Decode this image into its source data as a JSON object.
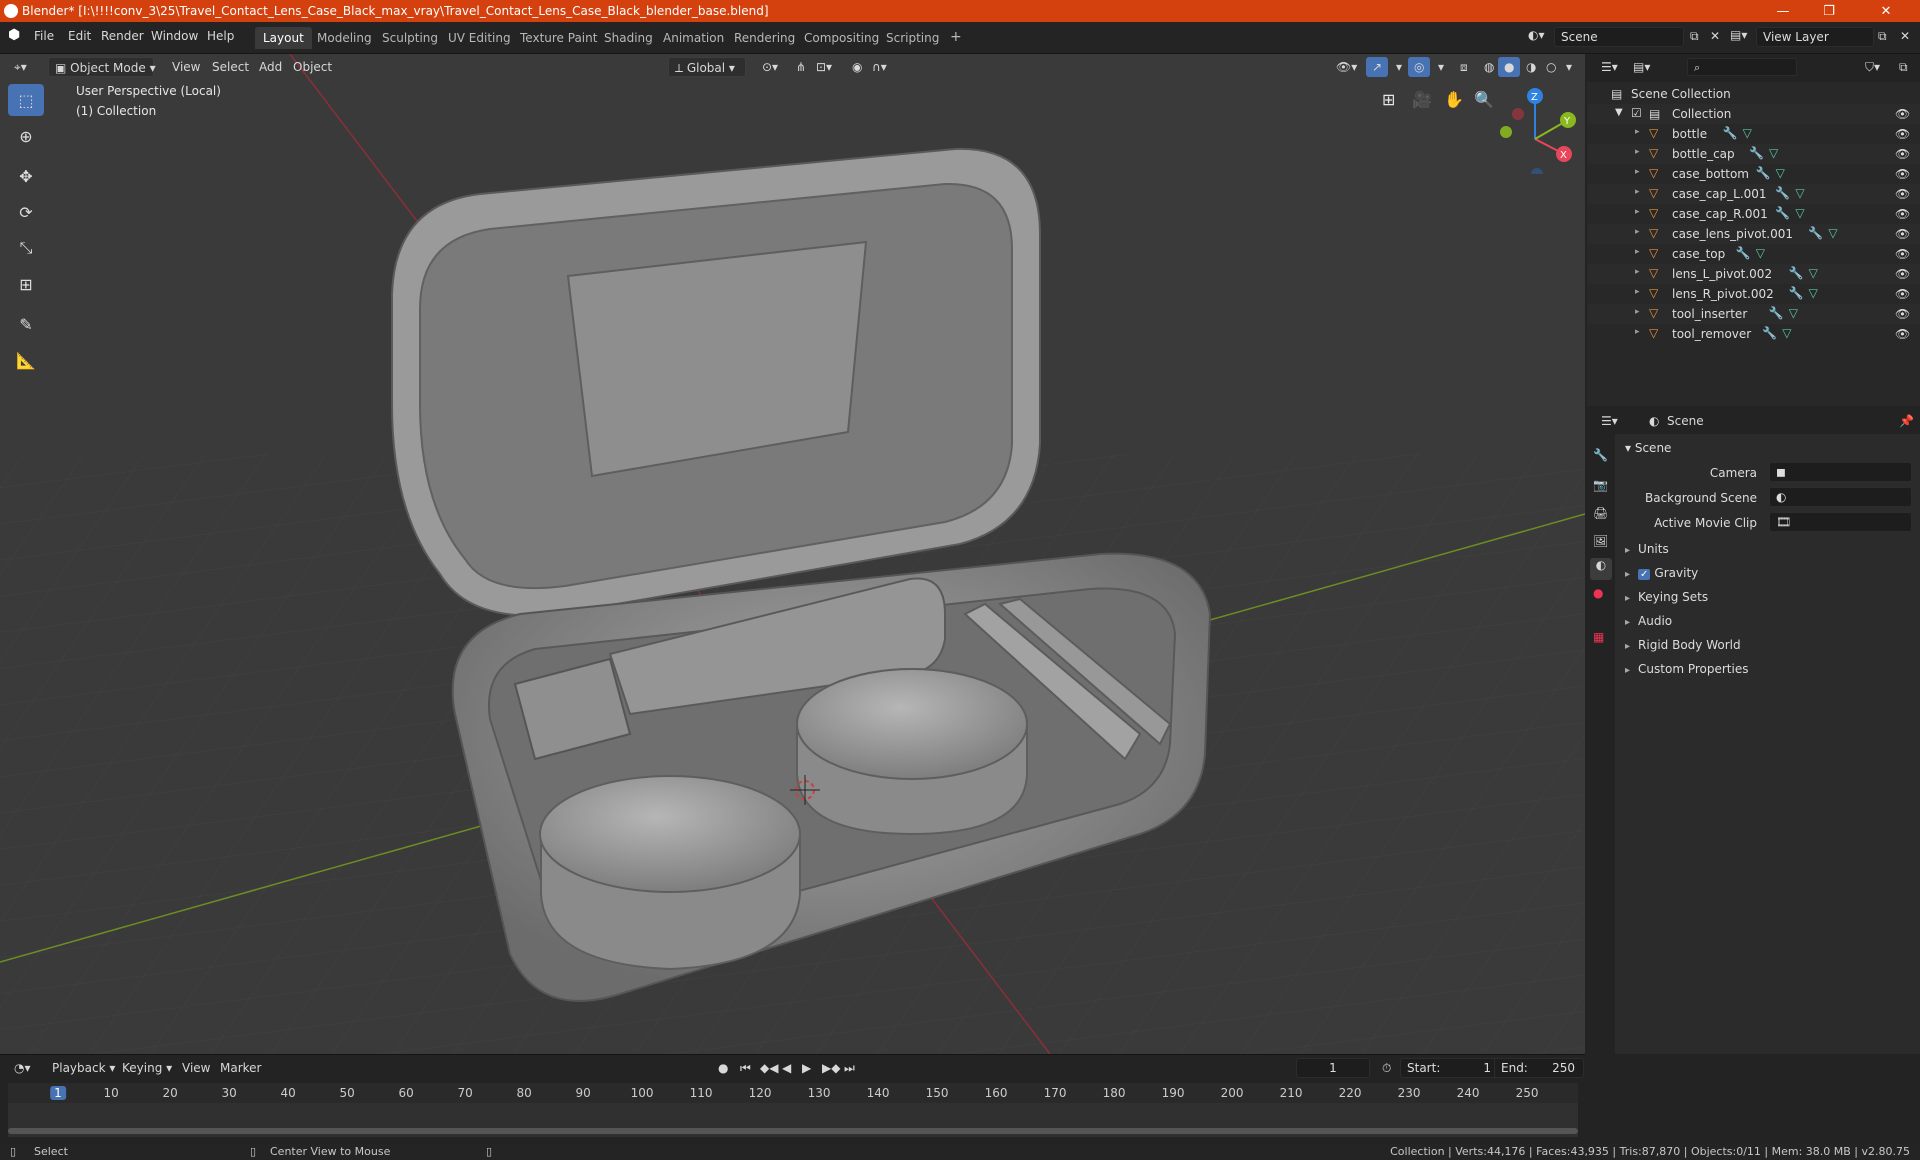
{
  "titlebar": {
    "title": "Blender* [I:\\!!!!conv_3\\25\\Travel_Contact_Lens_Case_Black_max_vray\\Travel_Contact_Lens_Case_Black_blender_base.blend]",
    "minimize": "—",
    "maximize": "❐",
    "close": "✕"
  },
  "menubar": {
    "items": [
      "File",
      "Edit",
      "Render",
      "Window",
      "Help"
    ],
    "workspaces": [
      "Layout",
      "Modeling",
      "Sculpting",
      "UV Editing",
      "Texture Paint",
      "Shading",
      "Animation",
      "Rendering",
      "Compositing",
      "Scripting"
    ],
    "add_workspace": "+",
    "scene": "Scene",
    "view_layer": "View Layer"
  },
  "viewport": {
    "mode": "Object Mode",
    "menus": [
      "View",
      "Select",
      "Add",
      "Object"
    ],
    "orientation": "Global",
    "perspective_label": "User Perspective (Local)",
    "collection_label": "(1) Collection",
    "gizmo": {
      "x": "X",
      "y": "Y",
      "z": "Z"
    }
  },
  "outliner": {
    "root": "Scene Collection",
    "collection": "Collection",
    "objects": [
      "bottle",
      "bottle_cap",
      "case_bottom",
      "case_cap_L.001",
      "case_cap_R.001",
      "case_lens_pivot.001",
      "case_top",
      "lens_L_pivot.002",
      "lens_R_pivot.002",
      "tool_inserter",
      "tool_remover"
    ]
  },
  "properties": {
    "header": "Scene",
    "panel": "Scene",
    "camera_label": "Camera",
    "background_scene_label": "Background Scene",
    "active_movie_clip_label": "Active Movie Clip",
    "sections": [
      "Units",
      "Gravity",
      "Keying Sets",
      "Audio",
      "Rigid Body World",
      "Custom Properties"
    ]
  },
  "timeline": {
    "menus": [
      "Playback",
      "Keying",
      "View",
      "Marker"
    ],
    "current_frame": "1",
    "start_label": "Start:",
    "start": "1",
    "end_label": "End:",
    "end": "250",
    "ticks": [
      "1",
      "10",
      "20",
      "30",
      "40",
      "50",
      "60",
      "70",
      "80",
      "90",
      "100",
      "110",
      "120",
      "130",
      "140",
      "150",
      "160",
      "170",
      "180",
      "190",
      "200",
      "210",
      "220",
      "230",
      "240",
      "250"
    ]
  },
  "statusbar": {
    "select": "Select",
    "center": "Center View to Mouse",
    "stats": "Collection | Verts:44,176 | Faces:43,935 | Tris:87,870 | Objects:0/11 | Mem: 38.0 MB | v2.80.75"
  },
  "colors": {
    "accent": "#4772b3",
    "titlebar": "#d4410f",
    "object_orange": "#e8923a",
    "mesh_green": "#59c7a5",
    "axis_x": "#e8475a",
    "axis_y": "#8ab81e",
    "axis_z": "#2f83e0"
  }
}
